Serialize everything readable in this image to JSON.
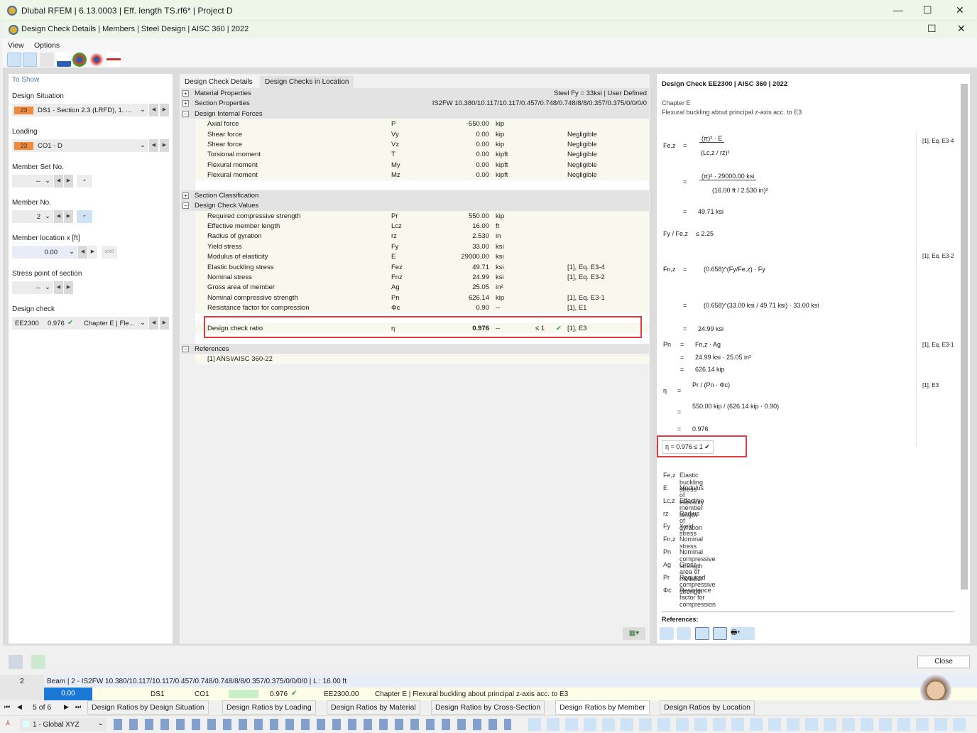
{
  "window": {
    "title": "Dlubal RFEM | 6.13.0003 | Eff. length TS.rf6* | Project D",
    "dialog_title": "Design Check Details | Members | Steel Design | AISC 360 | 2022"
  },
  "menu": [
    "View",
    "Options"
  ],
  "left": {
    "header": "To Show",
    "design_situation": {
      "label": "Design Situation",
      "badge": "23",
      "value": "DS1 - Section 2.3 (LRFD), 1. ..."
    },
    "loading": {
      "label": "Loading",
      "badge": "23",
      "value": "CO1 - D"
    },
    "member_set": {
      "label": "Member Set No.",
      "value": "--"
    },
    "member": {
      "label": "Member No.",
      "value": "2"
    },
    "location": {
      "label": "Member location x [ft]",
      "value": "0.00",
      "rel_label": "x/x0"
    },
    "stress_point": {
      "label": "Stress point of section",
      "value": "--"
    },
    "design_check": {
      "label": "Design check",
      "id": "EE2300",
      "ratio": "0.976",
      "desc": "Chapter E | Fle..."
    }
  },
  "mid": {
    "tabs": [
      "Design Check Details",
      "Design Checks in Location"
    ],
    "rows": [
      {
        "kind": "grp",
        "sign": "+",
        "label": "Material Properties",
        "right": "Steel Fy = 33ksi | User Defined"
      },
      {
        "kind": "grp",
        "sign": "+",
        "label": "Section Properties",
        "right": "IS2FW 10.380/10.117/10.117/0.457/0.748/0.748/8/8/0.357/0.375/0/0/0/0"
      },
      {
        "kind": "grp",
        "sign": "−",
        "label": "Design Internal Forces"
      },
      {
        "kind": "data",
        "label": "Axial force",
        "sym": "P",
        "val": "-550.00",
        "unit": "kip"
      },
      {
        "kind": "data",
        "label": "Shear force",
        "sym": "Vy",
        "val": "0.00",
        "unit": "kip",
        "note": "Negligible"
      },
      {
        "kind": "data",
        "label": "Shear force",
        "sym": "Vz",
        "val": "0.00",
        "unit": "kip",
        "note": "Negligible"
      },
      {
        "kind": "data",
        "label": "Torsional moment",
        "sym": "T",
        "val": "0.00",
        "unit": "kipft",
        "note": "Negligible"
      },
      {
        "kind": "data",
        "label": "Flexural moment",
        "sym": "My",
        "val": "0.00",
        "unit": "kipft",
        "note": "Negligible"
      },
      {
        "kind": "data",
        "label": "Flexural moment",
        "sym": "Mz",
        "val": "0.00",
        "unit": "kipft",
        "note": "Negligible"
      },
      {
        "kind": "blank"
      },
      {
        "kind": "grp",
        "sign": "+",
        "label": "Section Classification"
      },
      {
        "kind": "grp",
        "sign": "−",
        "label": "Design Check Values"
      },
      {
        "kind": "data",
        "label": "Required compressive strength",
        "sym": "Pr",
        "val": "550.00",
        "unit": "kip"
      },
      {
        "kind": "data",
        "label": "Effective member length",
        "sym": "Lcz",
        "val": "16.00",
        "unit": "ft"
      },
      {
        "kind": "data",
        "label": "Radius of gyration",
        "sym": "rz",
        "val": "2.530",
        "unit": "in"
      },
      {
        "kind": "data",
        "label": "Yield stress",
        "sym": "Fy",
        "val": "33.00",
        "unit": "ksi"
      },
      {
        "kind": "data",
        "label": "Modulus of elasticity",
        "sym": "E",
        "val": "29000.00",
        "unit": "ksi"
      },
      {
        "kind": "data",
        "label": "Elastic buckling stress",
        "sym": "Fez",
        "val": "49.71",
        "unit": "ksi",
        "note": "[1], Eq. E3-4"
      },
      {
        "kind": "data",
        "label": "Nominal stress",
        "sym": "Fnz",
        "val": "24.99",
        "unit": "ksi",
        "note": "[1], Eq. E3-2"
      },
      {
        "kind": "data",
        "label": "Gross area of member",
        "sym": "Ag",
        "val": "25.05",
        "unit": "in²"
      },
      {
        "kind": "data",
        "label": "Nominal compressive strength",
        "sym": "Pn",
        "val": "626.14",
        "unit": "kip",
        "note": "[1], Eq. E3-1"
      },
      {
        "kind": "data",
        "label": "Resistance factor for compression",
        "sym": "Φc",
        "val": "0.90",
        "unit": "--",
        "note": "[1], E1"
      },
      {
        "kind": "blank"
      },
      {
        "kind": "data",
        "bold": true,
        "label": "Design check ratio",
        "sym": "η",
        "val": "0.976",
        "unit": "--",
        "limit": "≤ 1",
        "check": "✔",
        "note": "[1], E3"
      },
      {
        "kind": "blank"
      },
      {
        "kind": "grp",
        "sign": "−",
        "label": "References"
      },
      {
        "kind": "data",
        "label": "[1]  ANSI/AISC 360-22"
      }
    ]
  },
  "right": {
    "title": "Design Check EE2300 | AISC 360 | 2022",
    "chapter": "Chapter E",
    "subtitle": "Flexural buckling about principal z-axis acc. to E3",
    "f": {
      "fez": "Fe,z",
      "eq": "=",
      "num1": "(π)² · E",
      "den1": "(Lc,z / rz)²",
      "num2": "(π)² · 29000.00 ksi",
      "den2": "(16.00 ft / 2.530 in)²",
      "res1": "49.71 ksi",
      "ratio_lhs": "Fy / Fe,z",
      "ratio_rhs": "≤ 2.25",
      "fnz": "Fn,z",
      "fnz1": "(0.658)^(Fy/Fe,z) · Fy",
      "fnz2": "(0.658)^(33.00 ksi / 49.71 ksi) · 33.00 ksi",
      "res2": "24.99 ksi",
      "pn": "Pn",
      "pn1": "Fn,z · Ag",
      "pn2": "24.99 ksi · 25.05 in²",
      "res3": "626.14 kip",
      "eta": "η",
      "eta1": "Pr / (Pn · Φc)",
      "eta2": "550.00 kip / (626.14 kip · 0.90)",
      "res4": "0.976",
      "final": "η   =   0.976  ≤ 1 ✔",
      "ref1": "[1], Eq. E3-4",
      "ref2": "[1], Eq. E3-2",
      "ref3": "[1], Eq. E3-1",
      "ref4": "[1], E3"
    },
    "legend": [
      [
        "Fe,z",
        "Elastic buckling stress"
      ],
      [
        "E",
        "Modulus of elasticity"
      ],
      [
        "Lc,z",
        "Effective member length"
      ],
      [
        "rz",
        "Radius of gyration"
      ],
      [
        "Fy",
        "Yield stress"
      ],
      [
        "Fn,z",
        "Nominal stress"
      ],
      [
        "Pn",
        "Nominal compressive strength"
      ],
      [
        "Ag",
        "Gross area of member"
      ],
      [
        "Pr",
        "Required compressive strength"
      ],
      [
        "Φc",
        "Resistance factor for compression"
      ]
    ],
    "references_label": "References:"
  },
  "buttons": {
    "close": "Close"
  },
  "grid": {
    "row_no": "2",
    "member_desc": "Beam | 2 - IS2FW 10.380/10.117/10.117/0.457/0.748/0.748/8/8/0.357/0.375/0/0/0/0 | L : 16.00 ft",
    "x": "0.00",
    "ds": "DS1",
    "co": "CO1",
    "ratio": "0.976",
    "check": "EE2300.00",
    "desc": "Chapter E | Flexural buckling about principal z-axis acc. to E3"
  },
  "nav": {
    "page": "5 of 6",
    "tabs": [
      "Design Ratios by Design Situation",
      "Design Ratios by Loading",
      "Design Ratios by Material",
      "Design Ratios by Cross-Section",
      "Design Ratios by Member",
      "Design Ratios by Location"
    ],
    "active": 4
  },
  "coord_system": "1 - Global XYZ",
  "colors": {
    "accent": "#f08a3c",
    "highlight": "#e23a40",
    "ok": "#2e9e4a"
  }
}
